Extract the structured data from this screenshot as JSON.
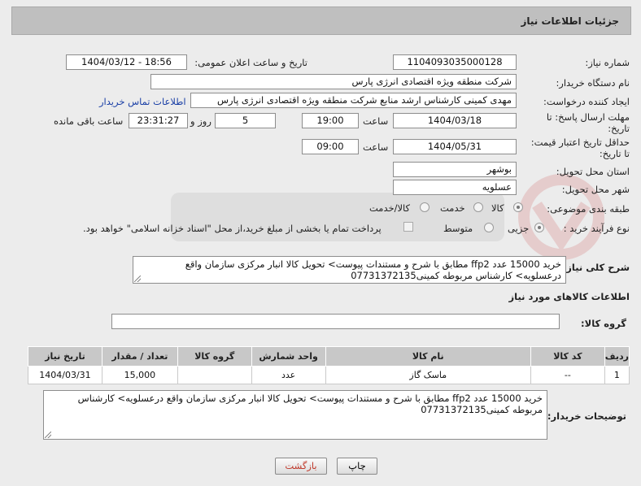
{
  "header": {
    "title": "جزئیات اطلاعات نیاز"
  },
  "need_number": {
    "label": "شماره نیاز:",
    "value": "1104093035000128"
  },
  "announce_datetime": {
    "label": "تاریخ و ساعت اعلان عمومی:",
    "value": "1404/03/12 - 18:56"
  },
  "buyer_org": {
    "label": "نام دستگاه خریدار:",
    "value": "شرکت منطقه ویژه اقتصادی انرژی پارس"
  },
  "requester": {
    "label": "ایجاد کننده درخواست:",
    "value": "مهدی کمینی کارشناس ارشد منابع شرکت منطقه ویژه اقتصادی انرژی پارس",
    "contact_link": "اطلاعات تماس خریدار"
  },
  "reply_deadline": {
    "label_line1": "مهلت ارسال پاسخ: تا",
    "label_line2": "تاریخ:",
    "date": "1404/03/18",
    "time_label": "ساعت",
    "time": "19:00",
    "days": "5",
    "days_label": "روز و",
    "remaining": "23:31:27",
    "remaining_label": "ساعت باقی مانده"
  },
  "price_validity": {
    "label_line1": "حداقل تاریخ اعتبار قیمت:",
    "label_line2": "تا تاریخ:",
    "date": "1404/05/31",
    "time_label": "ساعت",
    "time": "09:00"
  },
  "province": {
    "label": "استان محل تحویل:",
    "value": "بوشهر"
  },
  "city": {
    "label": "شهر محل تحویل:",
    "value": "عسلویه"
  },
  "category": {
    "label": "طبقه بندی موضوعی:",
    "options": [
      "کالا",
      "خدمت",
      "کالا/خدمت"
    ],
    "selected": "کالا"
  },
  "purchase_type": {
    "label": "نوع فرآیند خرید :",
    "options": [
      "جزیی",
      "متوسط"
    ],
    "selected": "جزیی",
    "payment_note": "پرداخت تمام یا بخشی از مبلغ خرید،از محل \"اسناد خزانه اسلامی\" خواهد بود."
  },
  "general_description": {
    "label": "شرح کلی نیاز:",
    "value": "خرید 15000  عدد ffp2 مطابق با شرح  و مستندات پیوست> تحویل کالا انبار مرکزی سازمان  واقع درعسلویه> کارشناس مربوطه کمینی07731372135"
  },
  "goods_section": {
    "title": "اطلاعات کالاهای مورد نیاز",
    "group_label": "گروه کالا:",
    "group_value": ""
  },
  "table": {
    "columns": [
      "ردیف",
      "کد کالا",
      "نام کالا",
      "واحد شمارش",
      "گروه کالا",
      "تعداد / مقدار",
      "تاریخ نیاز"
    ],
    "rows": [
      [
        "1",
        "--",
        "ماسک گاز",
        "عدد",
        "",
        "15,000",
        "1404/03/31"
      ]
    ]
  },
  "buyer_notes": {
    "label": "توضیحات خریدار:",
    "value": "خرید 15000 عدد ffp2 مطابق با شرح  و مستندات پیوست> تحویل کالا انبار مرکزی سازمان  واقع درعسلویه> کارشناس مربوطه کمینی07731372135"
  },
  "buttons": {
    "print": "چاپ",
    "back": "بازگشت"
  },
  "colors": {
    "title_bg": "#bfbfbf",
    "page_bg": "#ececec",
    "link": "#1a3fa6",
    "back_button_text": "#c0392b"
  }
}
